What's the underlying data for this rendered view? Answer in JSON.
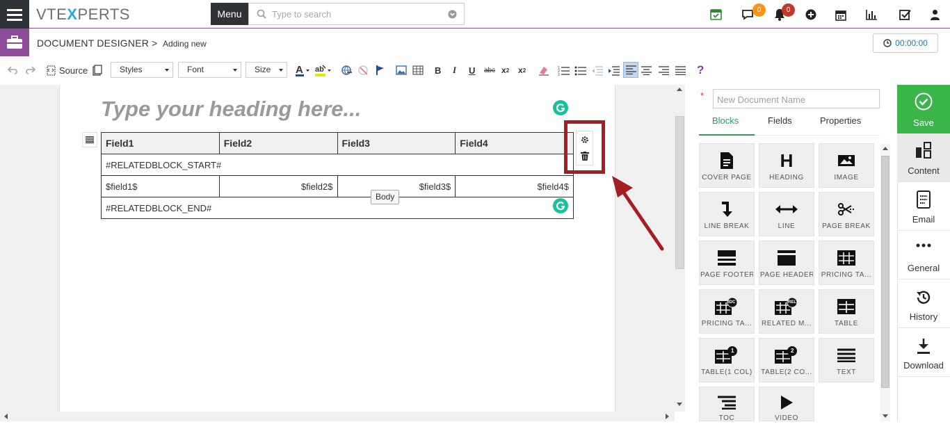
{
  "topbar": {
    "logo_pre": "VTE",
    "logo_x": "X",
    "logo_post": "PERTS",
    "menu_label": "Menu",
    "search_placeholder": "Type to search",
    "chat_badge": "0",
    "notif_badge": "0",
    "accent": "#8e4a9b"
  },
  "header": {
    "module": "DOCUMENT DESIGNER",
    "separator": ">",
    "page": "Adding new",
    "timer": "00:00:00"
  },
  "toolbar": {
    "source_label": "Source",
    "styles_label": "Styles",
    "font_label": "Font",
    "size_label": "Size",
    "help": "?"
  },
  "editor": {
    "heading_placeholder": "Type your heading here...",
    "table": {
      "headers": [
        "Field1",
        "Field2",
        "Field3",
        "Field4"
      ],
      "start_marker": "#RELATEDBLOCK_START#",
      "cells": [
        "$field1$",
        "$field2$",
        "$field3$",
        "$field4$"
      ],
      "end_marker": "#RELATEDBLOCK_END#"
    },
    "tooltip": "Body"
  },
  "panel": {
    "required_mark": "*",
    "docname_placeholder": "New Document Name",
    "tabs": [
      "Blocks",
      "Fields",
      "Properties"
    ],
    "blocks": [
      {
        "label": "COVER PAGE",
        "icon": "cover-page-icon"
      },
      {
        "label": "HEADING",
        "icon": "heading-icon"
      },
      {
        "label": "IMAGE",
        "icon": "image-icon"
      },
      {
        "label": "LINE BREAK",
        "icon": "line-break-icon"
      },
      {
        "label": "LINE",
        "icon": "line-icon"
      },
      {
        "label": "PAGE BREAK",
        "icon": "page-break-icon"
      },
      {
        "label": "PAGE FOOTER",
        "icon": "page-footer-icon"
      },
      {
        "label": "PAGE HEADER",
        "icon": "page-header-icon"
      },
      {
        "label": "PRICING TA...",
        "icon": "pricing-table-icon"
      },
      {
        "label": "PRICING TA...",
        "icon": "pricing-table-idc-icon"
      },
      {
        "label": "RELATED M...",
        "icon": "related-module-icon"
      },
      {
        "label": "TABLE",
        "icon": "table-icon"
      },
      {
        "label": "TABLE(1 COL)",
        "icon": "table-1col-icon"
      },
      {
        "label": "TABLE(2 CO...",
        "icon": "table-2col-icon"
      },
      {
        "label": "TEXT",
        "icon": "text-icon"
      },
      {
        "label": "TOC",
        "icon": "toc-icon"
      },
      {
        "label": "VIDEO",
        "icon": "video-icon"
      }
    ],
    "badges": {
      "idc": "IDC",
      "rel": "REL",
      "one": "1",
      "two": "2"
    },
    "heading_glyph": "H"
  },
  "sidebar": {
    "save": "Save",
    "content": "Content",
    "email": "Email",
    "general": "General",
    "history": "History",
    "download": "Download",
    "save_color": "#39b54a"
  }
}
